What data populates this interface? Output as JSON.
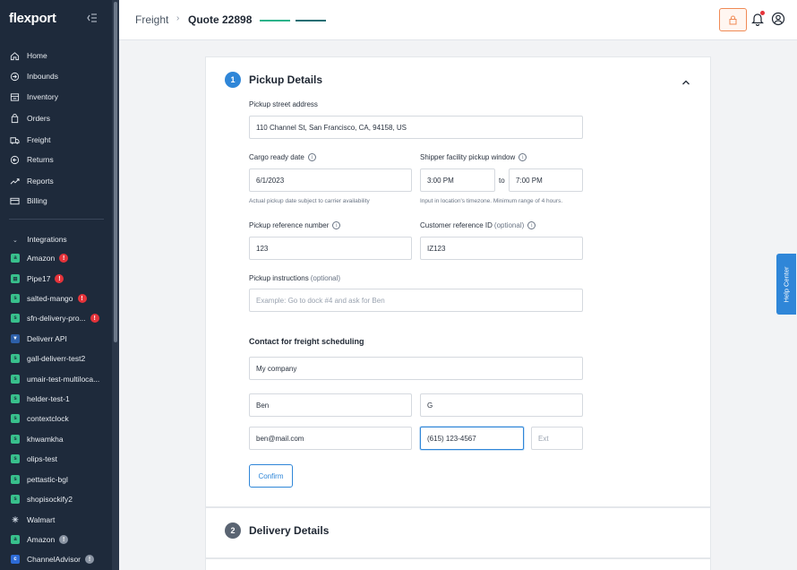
{
  "sidebar": {
    "brand": "flexport",
    "nav": [
      {
        "label": "Home",
        "icon": "home-icon"
      },
      {
        "label": "Inbounds",
        "icon": "inbound-icon"
      },
      {
        "label": "Inventory",
        "icon": "inventory-icon"
      },
      {
        "label": "Orders",
        "icon": "orders-icon"
      },
      {
        "label": "Freight",
        "icon": "freight-icon"
      },
      {
        "label": "Returns",
        "icon": "returns-icon"
      },
      {
        "label": "Reports",
        "icon": "reports-icon"
      },
      {
        "label": "Billing",
        "icon": "billing-icon"
      }
    ],
    "integrations_label": "Integrations",
    "integrations": [
      {
        "label": "Amazon",
        "badge": "!"
      },
      {
        "label": "Pipe17",
        "badge": "!"
      },
      {
        "label": "salted-mango",
        "badge": "!"
      },
      {
        "label": "sfn-delivery-pro...",
        "badge": "!"
      },
      {
        "label": "Deliverr API",
        "badge": ""
      },
      {
        "label": "gall-deliverr-test2",
        "badge": ""
      },
      {
        "label": "umair-test-multiloca...",
        "badge": ""
      },
      {
        "label": "helder-test-1",
        "badge": ""
      },
      {
        "label": "contextclock",
        "badge": ""
      },
      {
        "label": "khwamkha",
        "badge": ""
      },
      {
        "label": "olips-test",
        "badge": ""
      },
      {
        "label": "pettastic-bgl",
        "badge": ""
      },
      {
        "label": "shopisockify2",
        "badge": ""
      },
      {
        "label": "Walmart",
        "badge": ""
      },
      {
        "label": "Amazon",
        "badge": "!"
      },
      {
        "label": "ChannelAdvisor",
        "badge": "!"
      }
    ]
  },
  "header": {
    "breadcrumb_root": "Freight",
    "breadcrumb_sep": "›",
    "quote_title": "Quote 22898"
  },
  "pickup": {
    "step": "1",
    "title": "Pickup Details",
    "street_label": "Pickup street address",
    "street_value": "110 Channel St, San Francisco, CA, 94158, US",
    "cargo_label": "Cargo ready date",
    "cargo_value": "6/1/2023",
    "cargo_hint": "Actual pickup date subject to carrier availability",
    "window_label": "Shipper facility pickup window",
    "window_start": "3:00 PM",
    "window_to": "to",
    "window_end": "7:00 PM",
    "window_hint": "Input in location's timezone. Minimum range of 4 hours.",
    "ref_label": "Pickup reference number",
    "ref_value": "123",
    "cust_label": "Customer reference ID",
    "cust_optional": "(optional)",
    "cust_value": "IZ123",
    "instr_label": "Pickup instructions",
    "instr_optional": "(optional)",
    "instr_placeholder": "Example: Go to dock #4 and ask for Ben",
    "contact_heading": "Contact for freight scheduling",
    "company_value": "My company",
    "first_name": "Ben",
    "last_name": "G",
    "email": "ben@mail.com",
    "phone": "(615) 123-4567",
    "ext_placeholder": "Ext",
    "confirm_label": "Confirm"
  },
  "delivery": {
    "step": "2",
    "title": "Delivery Details"
  },
  "help_center": "Help Center",
  "colors": {
    "sidebar_bg": "#1e2a3b",
    "accent_blue": "#2f86d8",
    "step_inactive": "#5a6472",
    "progress_green": "#2bb38a",
    "progress_teal": "#1f6e73",
    "error_red": "#e5333a",
    "lock_orange": "#f08a55"
  }
}
